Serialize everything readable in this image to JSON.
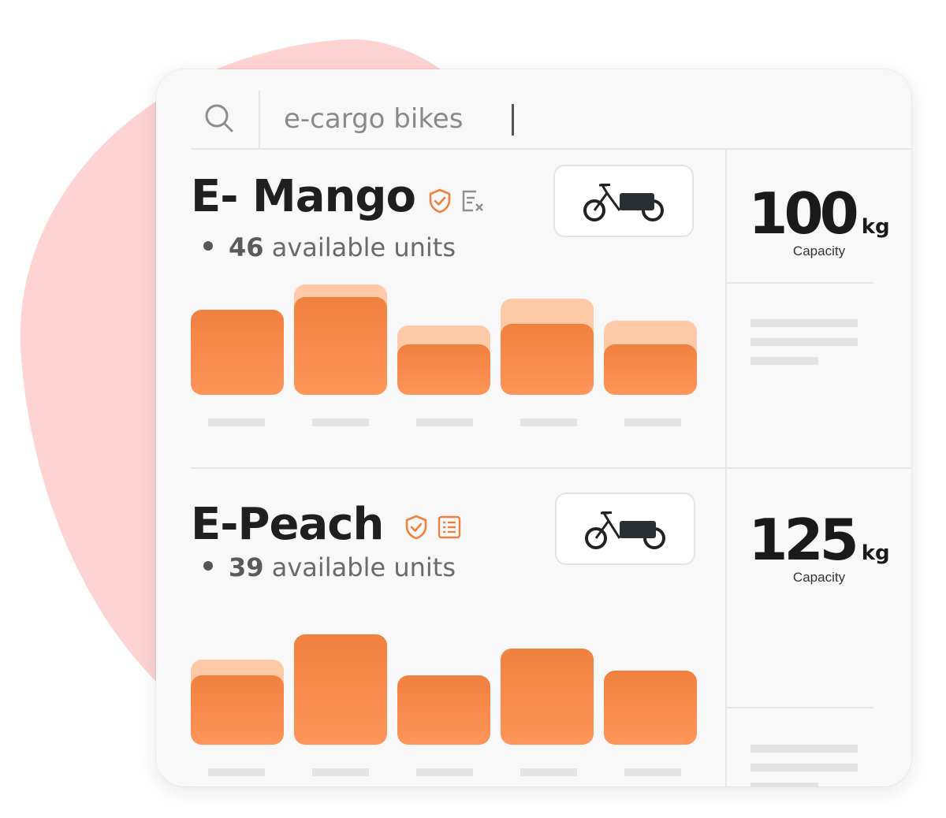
{
  "search": {
    "query": "e-cargo bikes",
    "icon": "search-icon"
  },
  "products": [
    {
      "name": "E- Mango",
      "units_count": "46",
      "units_text": " available units",
      "capacity_value": "100",
      "capacity_unit": "kg",
      "capacity_label": "Capacity",
      "icons": [
        "shield-check-icon",
        "list-remove-icon"
      ],
      "accent": "#f0803e"
    },
    {
      "name": "E-Peach",
      "units_count": "39",
      "units_text": " available units",
      "capacity_value": "125",
      "capacity_unit": "kg",
      "capacity_label": "Capacity",
      "icons": [
        "shield-check-icon",
        "list-icon"
      ],
      "accent": "#f0803e"
    }
  ],
  "colors": {
    "accent": "#f0803e",
    "ghost": "#fdc9a6",
    "background_blob": "#fdd4d3"
  }
}
